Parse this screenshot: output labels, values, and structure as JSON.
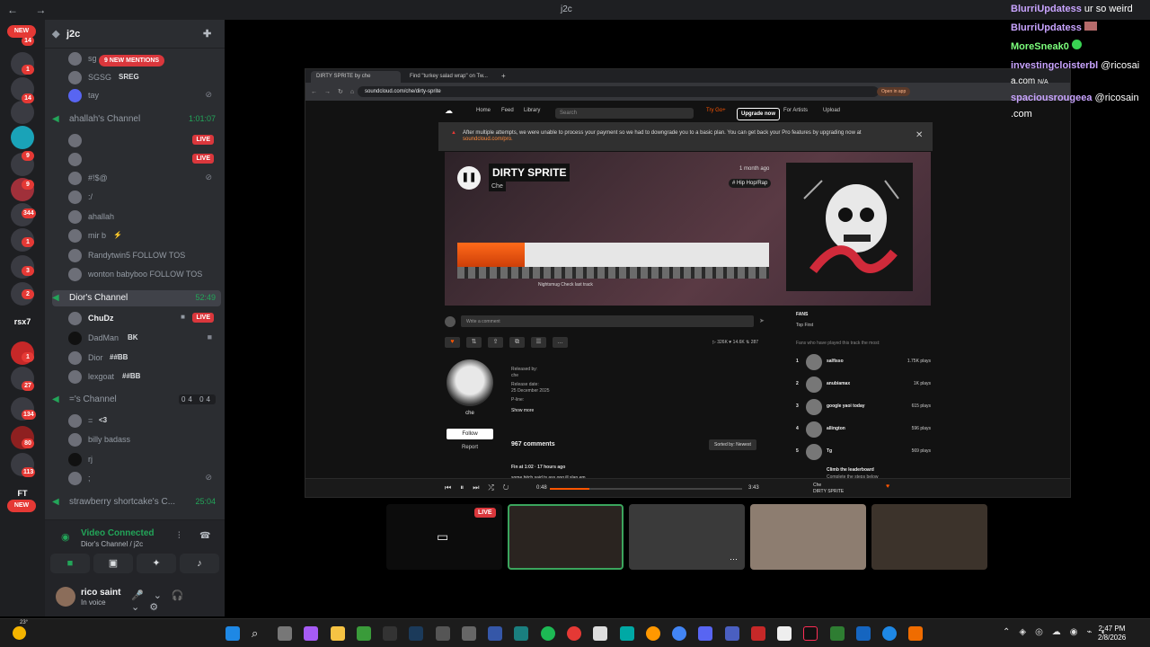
{
  "titlebar": {
    "nav": "← →",
    "title": "j2c"
  },
  "servers": {
    "new_top": "NEW",
    "new_bottom": "NEW",
    "badges": [
      "14",
      "1",
      "14",
      "",
      "9",
      "9",
      "344",
      "1",
      "3",
      "2",
      "",
      "1",
      "27",
      "134",
      "80",
      "113"
    ],
    "text_servers": [
      "rsx7",
      "FT"
    ]
  },
  "server_name": "j2c",
  "mention_pill": "9 NEW MENTIONS",
  "voice": {
    "top_users": [
      {
        "name": "sg",
        "tag": ""
      },
      {
        "name": "SGSG",
        "tag": "SREG"
      },
      {
        "name": "tay",
        "tag": ""
      }
    ],
    "channels": [
      {
        "name": "ahallah's Channel",
        "time": "1:01:07"
      },
      {
        "name": "Dior's Channel",
        "time": "52:49"
      },
      {
        "name": "='s Channel",
        "count": "04 04"
      },
      {
        "name": "strawberry shortcake's C...",
        "time": "25:04"
      }
    ],
    "ahallah_users": [
      {
        "name": "",
        "live": "LIVE"
      },
      {
        "name": "",
        "live": "LIVE"
      },
      {
        "name": "#!$@"
      },
      {
        "name": ":/"
      },
      {
        "name": "ahallah"
      },
      {
        "name": "mir b",
        "tag": "⚡"
      },
      {
        "name": "Randytwin5 FOLLOW TOS"
      },
      {
        "name": "wonton babyboo FOLLOW TOS"
      }
    ],
    "dior_users": [
      {
        "name": "ChuDz",
        "live": "LIVE"
      },
      {
        "name": "DadMan",
        "tag": "BK"
      },
      {
        "name": "Dior",
        "tag": "##BB"
      },
      {
        "name": "lexgoat",
        "tag": "##BB"
      }
    ],
    "eq_users": [
      {
        "name": "=",
        "tag": "<3"
      },
      {
        "name": "billy badass"
      },
      {
        "name": "rj"
      },
      {
        "name": ";"
      }
    ]
  },
  "voice_panel": {
    "status": "Video Connected",
    "sub": "Dior's Channel / j2c"
  },
  "user_panel": {
    "name": "rico saint",
    "status": "In voice"
  },
  "browser": {
    "tabs": [
      "DIRTY SPRITE by che",
      "Find \"turkey salad wrap\" on Tw..."
    ],
    "url": "soundcloud.com/che/dirty-sprite",
    "open_in_app": "Open in app",
    "sc_nav": {
      "home": "Home",
      "feed": "Feed",
      "library": "Library",
      "search": "Search",
      "try": "Try Go+",
      "upgrade": "Upgrade now",
      "artists": "For Artists",
      "upload": "Upload"
    },
    "banner": {
      "text": "After multiple attempts, we were unable to process your payment so we had to downgrade you to a basic plan. You can get back your Pro features by upgrading now at",
      "link": "soundcloud.com/pro."
    },
    "track": {
      "title": "DIRTY SPRITE",
      "artist": "Che",
      "ago": "1 month ago",
      "genre": "# Hip Hop/Rap",
      "wave_caption": "Nightsmug   Check last track"
    },
    "comment_placeholder": "Write a comment",
    "stats": "▷ 326K   ♥ 14.6K   ⇅ 287",
    "profile": {
      "name": "che",
      "follow": "Follow",
      "report": "Report"
    },
    "release": {
      "by_label": "Released by:",
      "by": "che",
      "date_label": "Release date:",
      "date": "25 December 2025",
      "pline": "P-line:",
      "more": "Show more"
    },
    "comments_count": "967 comments",
    "sorted": "Sorted by: Newest",
    "first_comment": {
      "user": "Fin at 1:02 · 17 hours ago",
      "text": "some bitch said ts ass ong ill slap em"
    },
    "fans": {
      "title": "FANS",
      "tabs": "Top   First",
      "sub": "Fans who have played this track the most:",
      "list": [
        {
          "rank": "1",
          "name": "salfisso",
          "plays": "1.75K plays"
        },
        {
          "rank": "2",
          "name": "anubiamax",
          "plays": "1K plays"
        },
        {
          "rank": "3",
          "name": "google yaoi today",
          "plays": "615 plays"
        },
        {
          "rank": "4",
          "name": "allington",
          "plays": "596 plays"
        },
        {
          "rank": "5",
          "name": "Tg",
          "plays": "569 plays"
        }
      ],
      "leader": "Climb the leaderboard",
      "leader_sub": "Complete the steps below"
    },
    "player": {
      "elapsed": "0:48",
      "total": "3:43",
      "artist": "Che",
      "track": "DIRTY SPRITE"
    }
  },
  "tiles": {
    "live": "LIVE"
  },
  "chat": [
    {
      "user": "BlurriUpdatess",
      "msg": "ur so weird",
      "color": "#c9a4ff"
    },
    {
      "user": "BlurriUpdatess",
      "msg": "",
      "color": "#c9a4ff"
    },
    {
      "user": "MoreSneak0",
      "msg": "",
      "color": "#7cff7c"
    },
    {
      "user": "investingcloisterbl",
      "msg": "@ricosai",
      "color": "#c9a4ff"
    },
    {
      "user": "a.com",
      "msg": "N/A",
      "color": "#ffffff"
    },
    {
      "user": "spaciousrougeea",
      "msg": "@ricosain",
      "color": "#c9a4ff"
    },
    {
      "user": ".com",
      "msg": "",
      "color": "#ffffff"
    }
  ],
  "taskbar": {
    "weather": "23°",
    "time": "2:47 PM",
    "date": "2/8/2026"
  }
}
